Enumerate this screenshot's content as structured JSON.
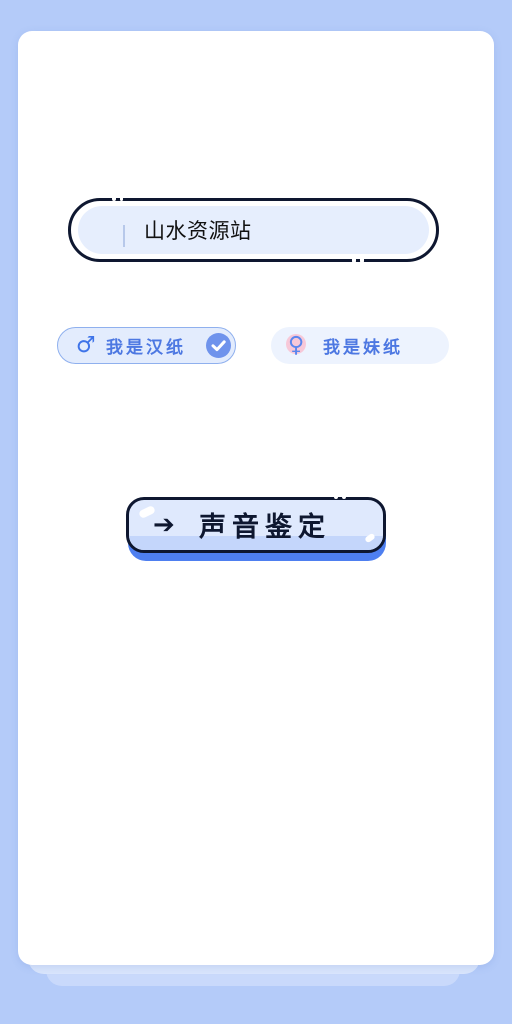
{
  "form": {
    "name_input": {
      "value": "山水资源站"
    },
    "gender_options": [
      {
        "symbol": "♂",
        "label": "我是汉纸",
        "selected": true,
        "icon": "male-symbol-icon"
      },
      {
        "symbol": "♀",
        "label": "我是妹纸",
        "selected": false,
        "icon": "female-symbol-icon"
      }
    ],
    "selected_icon": "check-circle-icon",
    "action_button": {
      "arrow": "➔",
      "label": "声音鉴定",
      "icon": "arrow-right-icon"
    }
  },
  "colors": {
    "page_background": "#b4cbf9",
    "card_background": "#ffffff",
    "accent_blue": "#4e7ff0",
    "outline_dark": "#0e1730",
    "input_fill": "#e6eefd",
    "gender_label_blue": "#4d78e2",
    "female_dot_pink": "#f7c8d8"
  }
}
